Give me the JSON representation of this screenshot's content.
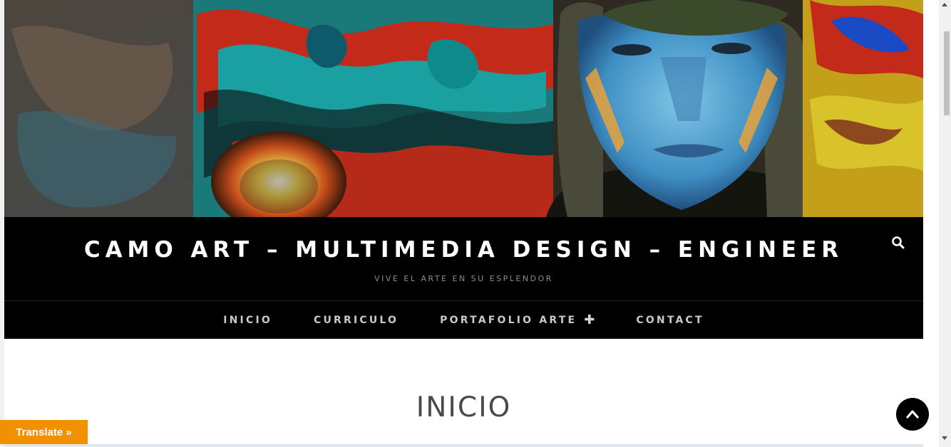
{
  "header": {
    "site_title": "CAMO ART – MULTIMEDIA DESIGN – ENGINEER",
    "tagline": "VIVE EL ARTE EN SU ESPLENDOR",
    "search_icon": "search-icon"
  },
  "nav": {
    "items": [
      {
        "label": "INICIO"
      },
      {
        "label": "CURRICULO"
      },
      {
        "label": "PORTAFOLIO ARTE",
        "submenu_icon": "plus-icon"
      },
      {
        "label": "CONTACT"
      }
    ]
  },
  "main": {
    "page_title": "INICIO"
  },
  "widgets": {
    "translate_label": "Translate »",
    "back_to_top_icon": "chevron-up-icon"
  },
  "colors": {
    "header_bg": "#000000",
    "translate_bg": "#f29100",
    "page_title": "#4a4a4a",
    "nav_text": "#c9c9c9"
  }
}
